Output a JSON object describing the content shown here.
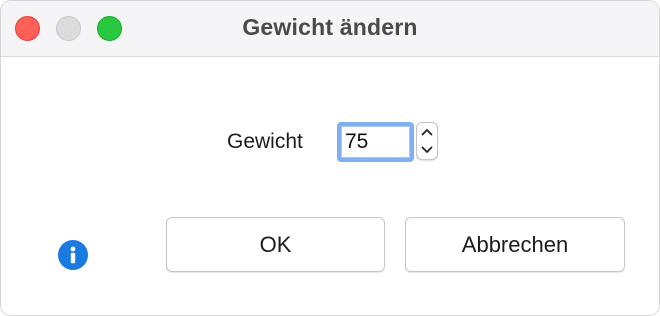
{
  "window": {
    "title": "Gewicht ändern"
  },
  "form": {
    "label": "Gewicht",
    "value": "75"
  },
  "buttons": {
    "ok_label": "OK",
    "cancel_label": "Abbrechen"
  },
  "icons": {
    "close": "close-icon",
    "minimize": "minimize-icon",
    "zoom": "zoom-icon",
    "stepper_up": "chevron-up-icon",
    "stepper_down": "chevron-down-icon",
    "info": "info-icon"
  },
  "colors": {
    "close": "#fe5f57",
    "minimize": "#dcdcdc",
    "zoom": "#28c840",
    "focus_ring": "#7fb0f0",
    "info": "#1a7ae0"
  }
}
